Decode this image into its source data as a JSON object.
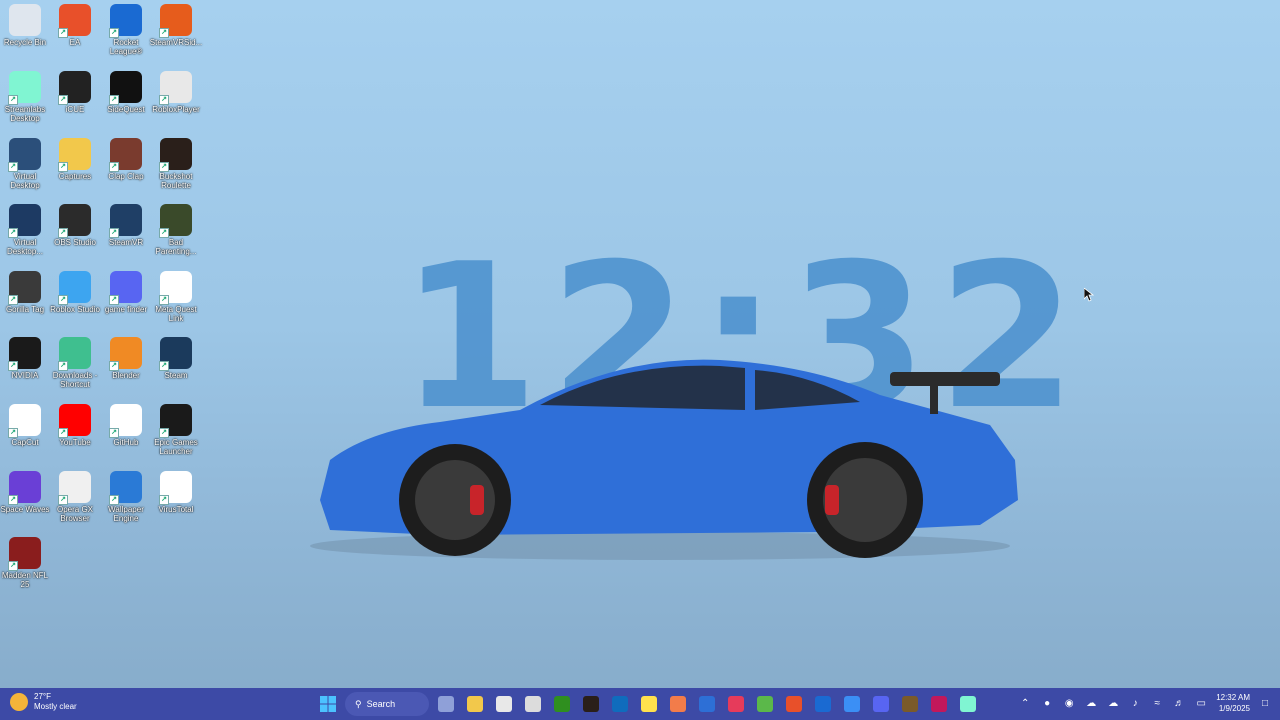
{
  "desktop": {
    "icons": [
      {
        "label": "Recycle Bin",
        "icon": "recycle-bin-icon",
        "color": "#dfe6ee"
      },
      {
        "label": "EA",
        "icon": "ea-icon",
        "color": "#e8502a"
      },
      {
        "label": "Rocket League®",
        "icon": "rocket-league-icon",
        "color": "#1a6ad2"
      },
      {
        "label": "SteamVRSid...",
        "icon": "steamvr-sid-icon",
        "color": "#e65c1c"
      },
      {
        "label": "Streamlabs Desktop",
        "icon": "streamlabs-icon",
        "color": "#80f5d2"
      },
      {
        "label": "iCUE",
        "icon": "icue-icon",
        "color": "#222222"
      },
      {
        "label": "SideQuest",
        "icon": "sidequest-icon",
        "color": "#111111"
      },
      {
        "label": "RobloxPlayer",
        "icon": "roblox-player-icon",
        "color": "#e8e8e8"
      },
      {
        "label": "Virtual Desktop",
        "icon": "virtual-desktop-icon",
        "color": "#2b4f7a"
      },
      {
        "label": "Captures",
        "icon": "folder-icon",
        "color": "#f2c84b"
      },
      {
        "label": "Clap Clap",
        "icon": "clap-clap-icon",
        "color": "#7a3b2e"
      },
      {
        "label": "Buckshot Roulette",
        "icon": "buckshot-roulette-icon",
        "color": "#2a1f1a"
      },
      {
        "label": "Virtual Desktop...",
        "icon": "virtual-desktop-streamer-icon",
        "color": "#1d3a63"
      },
      {
        "label": "OBS Studio",
        "icon": "obs-icon",
        "color": "#2b2b2b"
      },
      {
        "label": "SteamVR",
        "icon": "steamvr-icon",
        "color": "#1f3f66"
      },
      {
        "label": "Bad Parenting...",
        "icon": "bad-parenting-icon",
        "color": "#3a4a2a"
      },
      {
        "label": "Gorilla Tag",
        "icon": "gorilla-tag-icon",
        "color": "#3a3a3a"
      },
      {
        "label": "Roblox Studio",
        "icon": "roblox-studio-icon",
        "color": "#3da5f0"
      },
      {
        "label": "game finder",
        "icon": "discord-icon",
        "color": "#5865f2"
      },
      {
        "label": "Meta Quest Link",
        "icon": "meta-icon",
        "color": "#ffffff"
      },
      {
        "label": "NVIDIA",
        "icon": "nvidia-icon",
        "color": "#1a1a1a"
      },
      {
        "label": "Downloads - Shortcut",
        "icon": "downloads-folder-icon",
        "color": "#3fbf8f"
      },
      {
        "label": "Blender",
        "icon": "blender-icon",
        "color": "#f08a24"
      },
      {
        "label": "Steam",
        "icon": "steam-icon",
        "color": "#1b3a5c"
      },
      {
        "label": "CapCut",
        "icon": "capcut-icon",
        "color": "#ffffff"
      },
      {
        "label": "YouTube",
        "icon": "youtube-icon",
        "color": "#ff0000"
      },
      {
        "label": "GitHub",
        "icon": "github-icon",
        "color": "#ffffff"
      },
      {
        "label": "Epic Games Launcher",
        "icon": "epic-games-icon",
        "color": "#1a1a1a"
      },
      {
        "label": "Space Waves",
        "icon": "space-waves-icon",
        "color": "#6a3fd6"
      },
      {
        "label": "Opera GX Browser",
        "icon": "opera-gx-icon",
        "color": "#f0f0f0"
      },
      {
        "label": "Wallpaper Engine",
        "icon": "wallpaper-engine-icon",
        "color": "#2a7ad6"
      },
      {
        "label": "VirusTotal",
        "icon": "virustotal-icon",
        "color": "#ffffff"
      },
      {
        "label": "Madden NFL 25",
        "icon": "madden-icon",
        "color": "#8a1d1d"
      }
    ]
  },
  "wallpaper": {
    "clock_text": "12:32"
  },
  "taskbar": {
    "weather": {
      "temp": "27°F",
      "condition": "Mostly clear"
    },
    "search_label": "Search",
    "apps": [
      {
        "icon": "task-view-icon",
        "color": "#8fa0d8"
      },
      {
        "icon": "file-explorer-icon",
        "color": "#f2c84b"
      },
      {
        "icon": "microsoft-store-icon",
        "color": "#e8e8e8"
      },
      {
        "icon": "chat-icon",
        "color": "#dcdcdc"
      },
      {
        "icon": "nvidia-icon",
        "color": "#2f8f1f"
      },
      {
        "icon": "buckshot-icon",
        "color": "#2a1f1a"
      },
      {
        "icon": "outlook-icon",
        "color": "#0f6cbd"
      },
      {
        "icon": "norton-icon",
        "color": "#ffe14d"
      },
      {
        "icon": "hand-icon",
        "color": "#f27c4a"
      },
      {
        "icon": "edge-icon",
        "color": "#2d6fd6"
      },
      {
        "icon": "opera-icon",
        "color": "#e63b5b"
      },
      {
        "icon": "xbox-icon",
        "color": "#5bb84a"
      },
      {
        "icon": "ea-icon",
        "color": "#e8502a"
      },
      {
        "icon": "rocket-league-icon",
        "color": "#1a6ad2"
      },
      {
        "icon": "facebook-icon",
        "color": "#3b8ff5"
      },
      {
        "icon": "discord-icon",
        "color": "#5865f2"
      },
      {
        "icon": "buckshot-roulette-icon",
        "color": "#7a5a2a"
      },
      {
        "icon": "opera-gx-icon",
        "color": "#c2185b"
      },
      {
        "icon": "streamlabs-icon",
        "color": "#80f5d2"
      }
    ],
    "clock": {
      "time": "12:32 AM",
      "date": "1/9/2025"
    }
  }
}
